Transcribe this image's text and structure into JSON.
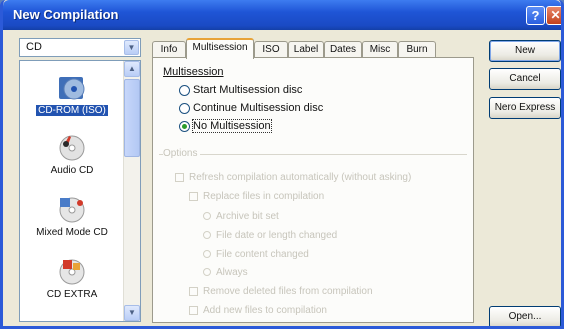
{
  "window": {
    "title": "New Compilation"
  },
  "titlebar": {
    "help": "?",
    "close": "✕"
  },
  "disc_type": {
    "value": "CD"
  },
  "compilation_list": {
    "items": [
      {
        "label": "CD-ROM (ISO)",
        "icon": "cdrom-iso-icon",
        "selected": true
      },
      {
        "label": "Audio CD",
        "icon": "audio-cd-icon",
        "selected": false
      },
      {
        "label": "Mixed Mode CD",
        "icon": "mixed-mode-cd-icon",
        "selected": false
      },
      {
        "label": "CD EXTRA",
        "icon": "cd-extra-icon",
        "selected": false
      }
    ]
  },
  "tabs": [
    {
      "label": "Info"
    },
    {
      "label": "Multisession",
      "active": true
    },
    {
      "label": "ISO"
    },
    {
      "label": "Label"
    },
    {
      "label": "Dates"
    },
    {
      "label": "Misc"
    },
    {
      "label": "Burn"
    }
  ],
  "multisession": {
    "group_label": "Multisession",
    "options": [
      {
        "label": "Start Multisession disc",
        "checked": false
      },
      {
        "label": "Continue Multisession disc",
        "checked": false
      },
      {
        "label": "No Multisession",
        "checked": true
      }
    ]
  },
  "options": {
    "label": "Options",
    "refresh": "Refresh compilation automatically (without asking)",
    "replace": "Replace files in compilation",
    "archive": "Archive bit set",
    "size_changed": "File date or length changed",
    "content_changed": "File content changed",
    "always": "Always",
    "remove": "Remove deleted files from compilation",
    "add": "Add new files to compilation"
  },
  "buttons": {
    "new": "New",
    "cancel": "Cancel",
    "nero_express": "Nero Express",
    "open": "Open..."
  },
  "colors": {
    "title_bar": "#1f55d6",
    "selection": "#2253b0",
    "active_tab_accent": "#e8a338"
  }
}
